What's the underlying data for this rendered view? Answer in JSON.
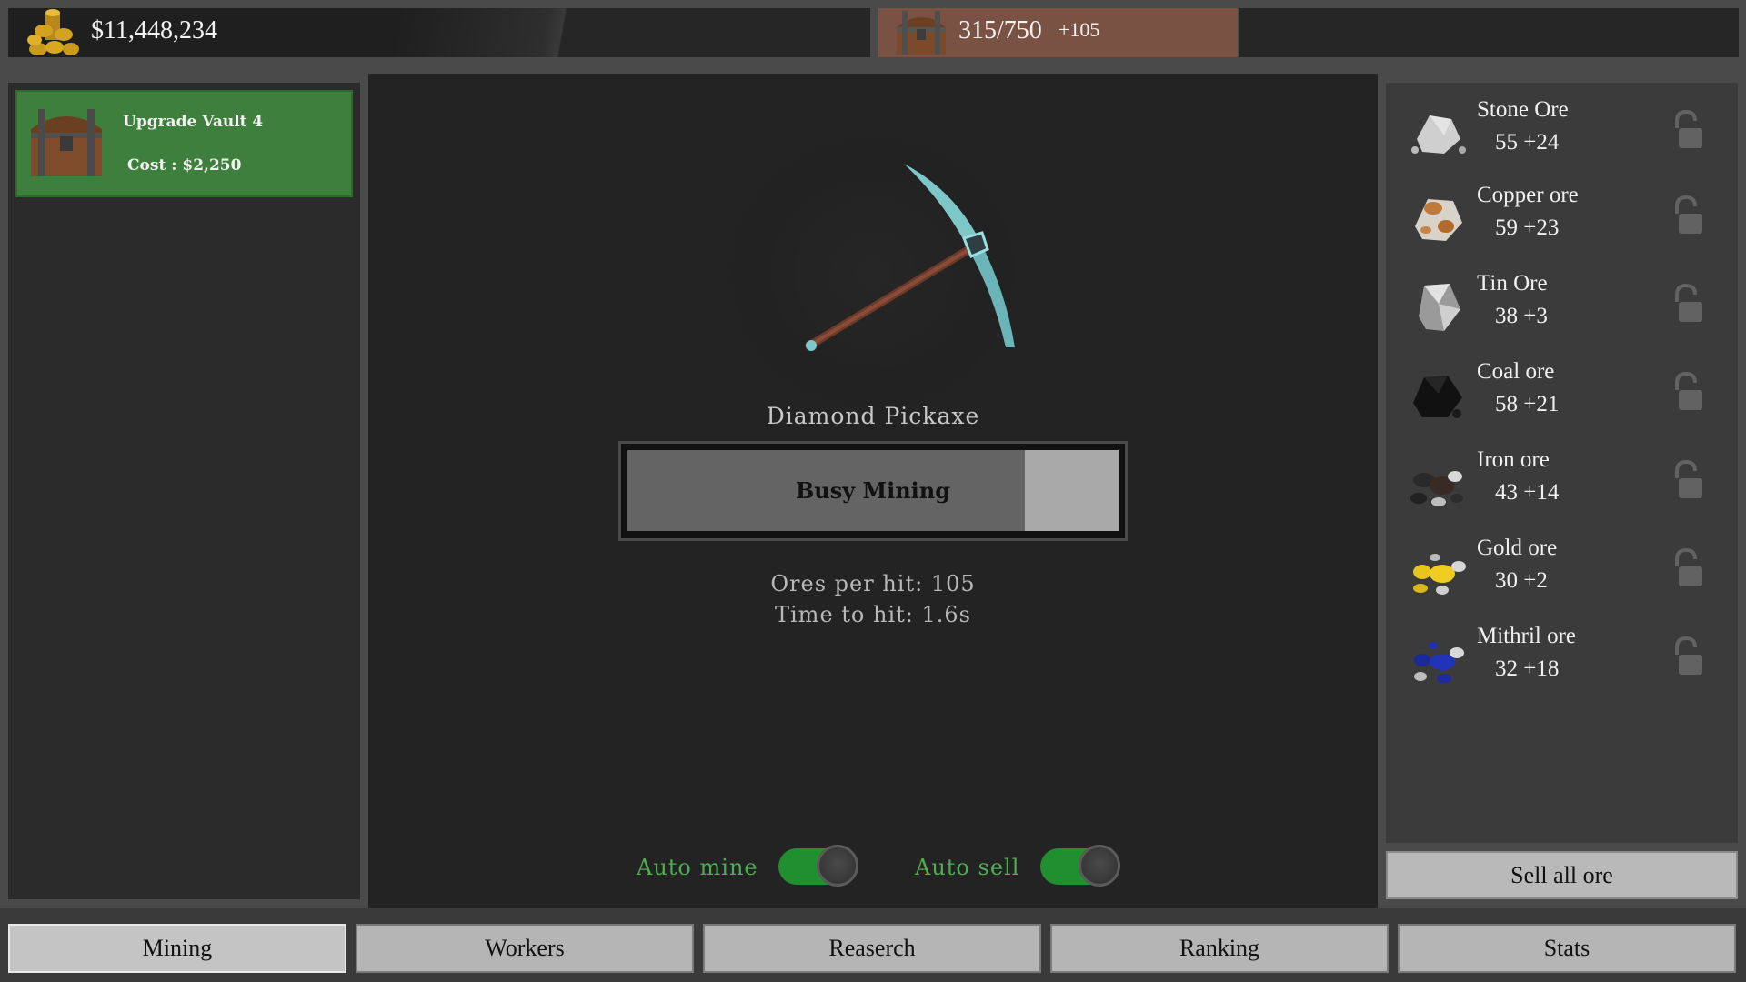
{
  "header": {
    "money": "$11,448,234",
    "storage": "315/750",
    "storage_gain": "+105"
  },
  "upgrade": {
    "title": "Upgrade Vault 4",
    "cost": "Cost : $2,250"
  },
  "tool": {
    "name": "Diamond Pickaxe",
    "mining_label": "Busy Mining",
    "progress": 0.81,
    "ores_per_hit": "Ores per hit: 105",
    "time_to_hit": "Time to hit: 1.6s"
  },
  "toggles": {
    "auto_mine_label": "Auto mine",
    "auto_mine_on": true,
    "auto_sell_label": "Auto sell",
    "auto_sell_on": true
  },
  "ores": [
    {
      "name": "Stone Ore",
      "count": "55 +24"
    },
    {
      "name": "Copper ore",
      "count": "59 +23"
    },
    {
      "name": "Tin Ore",
      "count": "38 +3"
    },
    {
      "name": "Coal ore",
      "count": "58 +21"
    },
    {
      "name": "Iron ore",
      "count": "43 +14"
    },
    {
      "name": "Gold ore",
      "count": "30 +2"
    },
    {
      "name": "Mithril ore",
      "count": "32 +18"
    }
  ],
  "sell_all_label": "Sell all ore",
  "nav": [
    {
      "label": "Mining",
      "active": true
    },
    {
      "label": "Workers",
      "active": false
    },
    {
      "label": "Reaserch",
      "active": false
    },
    {
      "label": "Ranking",
      "active": false
    },
    {
      "label": "Stats",
      "active": false
    }
  ],
  "colors": {
    "upgrade_bg": "#3f7f3d",
    "storage_bg": "#7a5243",
    "toggle_on": "#1f8f2f",
    "toggle_label": "#4fae4f",
    "progress_fill": "#646464",
    "progress_track": "#a9a9a9"
  }
}
